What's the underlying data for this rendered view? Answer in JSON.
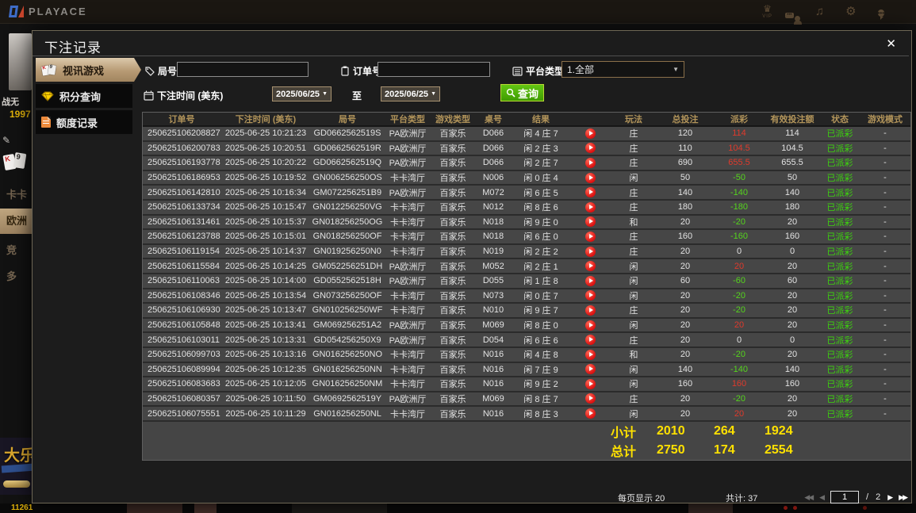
{
  "topbar": {
    "logo_text": "PLAYACE",
    "vip_label": "VIP"
  },
  "background": {
    "name": "战无",
    "points": "1997",
    "edit_glyph": "✎",
    "halls": [
      "卡卡",
      "欧洲",
      "竞",
      "多"
    ],
    "promo_text": "大乐",
    "bottom_number": "11261"
  },
  "modal": {
    "title": "下注记录",
    "close_glyph": "✕",
    "tabs": [
      {
        "label": "视讯游戏"
      },
      {
        "label": "积分查询"
      },
      {
        "label": "额度记录"
      }
    ],
    "filters": {
      "round_label": "局号",
      "round_value": "",
      "order_label": "订单号",
      "order_value": "",
      "platform_label": "平台类型",
      "platform_value": "1.全部",
      "select_arrow": "▼",
      "time_label": "下注时间 (美东)",
      "date_from": "2025/06/25",
      "to_label": "至",
      "date_to": "2025/06/25",
      "search_label": "查询"
    },
    "table": {
      "headers": [
        "订单号",
        "下注时间 (美东)",
        "局号",
        "平台类型",
        "游戏类型",
        "桌号",
        "结果",
        "",
        "玩法",
        "总投注",
        "派彩",
        "有效投注额",
        "状态",
        "游戏模式"
      ],
      "rows": [
        {
          "order": "250625106208827",
          "time": "2025-06-25 10:21:23",
          "round": "GD0662562519S",
          "platform": "PA欧洲厅",
          "game": "百家乐",
          "table": "D066",
          "result": "闲 4 庄 7",
          "play": "庄",
          "bet": "120",
          "payout": "114",
          "payout_color": "win",
          "valid": "114",
          "status": "已派彩",
          "mode": "-"
        },
        {
          "order": "250625106200783",
          "time": "2025-06-25 10:20:51",
          "round": "GD0662562519R",
          "platform": "PA欧洲厅",
          "game": "百家乐",
          "table": "D066",
          "result": "闲 2 庄 3",
          "play": "庄",
          "bet": "110",
          "payout": "104.5",
          "payout_color": "win",
          "valid": "104.5",
          "status": "已派彩",
          "mode": "-"
        },
        {
          "order": "250625106193778",
          "time": "2025-06-25 10:20:22",
          "round": "GD0662562519Q",
          "platform": "PA欧洲厅",
          "game": "百家乐",
          "table": "D066",
          "result": "闲 2 庄 7",
          "play": "庄",
          "bet": "690",
          "payout": "655.5",
          "payout_color": "win",
          "valid": "655.5",
          "status": "已派彩",
          "mode": "-"
        },
        {
          "order": "250625106186953",
          "time": "2025-06-25 10:19:52",
          "round": "GN006256250OS",
          "platform": "卡卡湾厅",
          "game": "百家乐",
          "table": "N006",
          "result": "闲 0 庄 4",
          "play": "闲",
          "bet": "50",
          "payout": "-50",
          "payout_color": "loss",
          "valid": "50",
          "status": "已派彩",
          "mode": "-"
        },
        {
          "order": "250625106142810",
          "time": "2025-06-25 10:16:34",
          "round": "GM072256251B9",
          "platform": "PA欧洲厅",
          "game": "百家乐",
          "table": "M072",
          "result": "闲 6 庄 5",
          "play": "庄",
          "bet": "140",
          "payout": "-140",
          "payout_color": "loss",
          "valid": "140",
          "status": "已派彩",
          "mode": "-"
        },
        {
          "order": "250625106133734",
          "time": "2025-06-25 10:15:47",
          "round": "GN012256250VG",
          "platform": "卡卡湾厅",
          "game": "百家乐",
          "table": "N012",
          "result": "闲 8 庄 6",
          "play": "庄",
          "bet": "180",
          "payout": "-180",
          "payout_color": "loss",
          "valid": "180",
          "status": "已派彩",
          "mode": "-"
        },
        {
          "order": "250625106131461",
          "time": "2025-06-25 10:15:37",
          "round": "GN018256250OG",
          "platform": "卡卡湾厅",
          "game": "百家乐",
          "table": "N018",
          "result": "闲 9 庄 0",
          "play": "和",
          "bet": "20",
          "payout": "-20",
          "payout_color": "loss",
          "valid": "20",
          "status": "已派彩",
          "mode": "-"
        },
        {
          "order": "250625106123788",
          "time": "2025-06-25 10:15:01",
          "round": "GN018256250OF",
          "platform": "卡卡湾厅",
          "game": "百家乐",
          "table": "N018",
          "result": "闲 6 庄 0",
          "play": "庄",
          "bet": "160",
          "payout": "-160",
          "payout_color": "loss",
          "valid": "160",
          "status": "已派彩",
          "mode": "-"
        },
        {
          "order": "250625106119154",
          "time": "2025-06-25 10:14:37",
          "round": "GN019256250N0",
          "platform": "卡卡湾厅",
          "game": "百家乐",
          "table": "N019",
          "result": "闲 2 庄 2",
          "play": "庄",
          "bet": "20",
          "payout": "0",
          "payout_color": "zero",
          "valid": "0",
          "status": "已派彩",
          "mode": "-"
        },
        {
          "order": "250625106115584",
          "time": "2025-06-25 10:14:25",
          "round": "GM052256251DH",
          "platform": "PA欧洲厅",
          "game": "百家乐",
          "table": "M052",
          "result": "闲 2 庄 1",
          "play": "闲",
          "bet": "20",
          "payout": "20",
          "payout_color": "win",
          "valid": "20",
          "status": "已派彩",
          "mode": "-"
        },
        {
          "order": "250625106110063",
          "time": "2025-06-25 10:14:00",
          "round": "GD0552562518H",
          "platform": "PA欧洲厅",
          "game": "百家乐",
          "table": "D055",
          "result": "闲 1 庄 8",
          "play": "闲",
          "bet": "60",
          "payout": "-60",
          "payout_color": "loss",
          "valid": "60",
          "status": "已派彩",
          "mode": "-"
        },
        {
          "order": "250625106108346",
          "time": "2025-06-25 10:13:54",
          "round": "GN073256250OF",
          "platform": "卡卡湾厅",
          "game": "百家乐",
          "table": "N073",
          "result": "闲 0 庄 7",
          "play": "闲",
          "bet": "20",
          "payout": "-20",
          "payout_color": "loss",
          "valid": "20",
          "status": "已派彩",
          "mode": "-"
        },
        {
          "order": "250625106106930",
          "time": "2025-06-25 10:13:47",
          "round": "GN010256250WF",
          "platform": "卡卡湾厅",
          "game": "百家乐",
          "table": "N010",
          "result": "闲 9 庄 7",
          "play": "庄",
          "bet": "20",
          "payout": "-20",
          "payout_color": "loss",
          "valid": "20",
          "status": "已派彩",
          "mode": "-"
        },
        {
          "order": "250625106105848",
          "time": "2025-06-25 10:13:41",
          "round": "GM069256251A2",
          "platform": "PA欧洲厅",
          "game": "百家乐",
          "table": "M069",
          "result": "闲 8 庄 0",
          "play": "闲",
          "bet": "20",
          "payout": "20",
          "payout_color": "win",
          "valid": "20",
          "status": "已派彩",
          "mode": "-"
        },
        {
          "order": "250625106103011",
          "time": "2025-06-25 10:13:31",
          "round": "GD054256250X9",
          "platform": "PA欧洲厅",
          "game": "百家乐",
          "table": "D054",
          "result": "闲 6 庄 6",
          "play": "庄",
          "bet": "20",
          "payout": "0",
          "payout_color": "zero",
          "valid": "0",
          "status": "已派彩",
          "mode": "-"
        },
        {
          "order": "250625106099703",
          "time": "2025-06-25 10:13:16",
          "round": "GN016256250NO",
          "platform": "卡卡湾厅",
          "game": "百家乐",
          "table": "N016",
          "result": "闲 4 庄 8",
          "play": "和",
          "bet": "20",
          "payout": "-20",
          "payout_color": "loss",
          "valid": "20",
          "status": "已派彩",
          "mode": "-"
        },
        {
          "order": "250625106089994",
          "time": "2025-06-25 10:12:35",
          "round": "GN016256250NN",
          "platform": "卡卡湾厅",
          "game": "百家乐",
          "table": "N016",
          "result": "闲 7 庄 9",
          "play": "闲",
          "bet": "140",
          "payout": "-140",
          "payout_color": "loss",
          "valid": "140",
          "status": "已派彩",
          "mode": "-"
        },
        {
          "order": "250625106083683",
          "time": "2025-06-25 10:12:05",
          "round": "GN016256250NM",
          "platform": "卡卡湾厅",
          "game": "百家乐",
          "table": "N016",
          "result": "闲 9 庄 2",
          "play": "闲",
          "bet": "160",
          "payout": "160",
          "payout_color": "win",
          "valid": "160",
          "status": "已派彩",
          "mode": "-"
        },
        {
          "order": "250625106080357",
          "time": "2025-06-25 10:11:50",
          "round": "GM0692562519Y",
          "platform": "PA欧洲厅",
          "game": "百家乐",
          "table": "M069",
          "result": "闲 8 庄 7",
          "play": "庄",
          "bet": "20",
          "payout": "-20",
          "payout_color": "loss",
          "valid": "20",
          "status": "已派彩",
          "mode": "-"
        },
        {
          "order": "250625106075551",
          "time": "2025-06-25 10:11:29",
          "round": "GN016256250NL",
          "platform": "卡卡湾厅",
          "game": "百家乐",
          "table": "N016",
          "result": "闲 8 庄 3",
          "play": "闲",
          "bet": "20",
          "payout": "20",
          "payout_color": "win",
          "valid": "20",
          "status": "已派彩",
          "mode": "-"
        }
      ],
      "subtotal_label": "小计",
      "subtotal": [
        "2010",
        "264",
        "1924"
      ],
      "total_label": "总计",
      "total": [
        "2750",
        "174",
        "2554"
      ]
    },
    "footer": {
      "per_page": "每页显示 20",
      "total_count": "共计: 37",
      "current_page": "1",
      "page_divider": "/",
      "total_pages": "2"
    }
  }
}
